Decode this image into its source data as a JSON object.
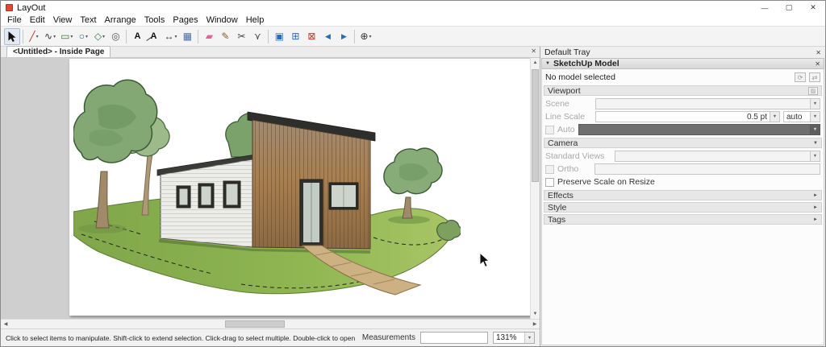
{
  "window": {
    "title": "LayOut"
  },
  "ui": {
    "minimize": "—",
    "maximize": "▢",
    "close": "✕",
    "dropdown_arrow": "▾",
    "combo_arrow": "▼",
    "panel_collapse": "▼",
    "section_expand": "►",
    "section_collapse": "▼",
    "scroll_up": "▲",
    "scroll_down": "▼",
    "scroll_left": "◀",
    "scroll_right": "▶",
    "refresh": "⟳",
    "swap": "⇄",
    "edit_view": "▨"
  },
  "menu": {
    "items": [
      "File",
      "Edit",
      "View",
      "Text",
      "Arrange",
      "Tools",
      "Pages",
      "Window",
      "Help"
    ]
  },
  "toolbar": {
    "tools": [
      {
        "id": "select",
        "glyph": ""
      },
      {
        "id": "line",
        "glyph": "╱"
      },
      {
        "id": "freehand",
        "glyph": "∿"
      },
      {
        "id": "rectangle",
        "glyph": "▭"
      },
      {
        "id": "circle",
        "glyph": "○"
      },
      {
        "id": "polygon",
        "glyph": "◇"
      },
      {
        "id": "offset",
        "glyph": "◎"
      },
      {
        "id": "text",
        "glyph": "A"
      },
      {
        "id": "label",
        "glyph": "A"
      },
      {
        "id": "dimension",
        "glyph": "↔"
      },
      {
        "id": "table",
        "glyph": "▦"
      },
      {
        "id": "eraser",
        "glyph": "▰"
      },
      {
        "id": "style",
        "glyph": "✎"
      },
      {
        "id": "split",
        "glyph": "✂"
      },
      {
        "id": "join",
        "glyph": "⋎"
      },
      {
        "id": "presentation",
        "glyph": "▣"
      },
      {
        "id": "add-page",
        "glyph": "⊞"
      },
      {
        "id": "delete-page",
        "glyph": "⊠"
      },
      {
        "id": "previous-page",
        "glyph": "◀"
      },
      {
        "id": "next-page",
        "glyph": "▶"
      },
      {
        "id": "zoom",
        "glyph": "⊕"
      }
    ]
  },
  "tab": {
    "label": "<Untitled> - Inside Page"
  },
  "tray": {
    "title": "Default Tray",
    "model_panel": {
      "title": "SketchUp Model",
      "status": "No model selected",
      "viewport_section": "Viewport",
      "scene_label": "Scene",
      "line_scale_label": "Line Scale",
      "line_scale_value": "0.5 pt",
      "line_scale_unit": "auto",
      "auto_label": "Auto",
      "camera_section": "Camera",
      "standard_views_label": "Standard Views",
      "ortho_label": "Ortho",
      "preserve_label": "Preserve Scale on Resize",
      "effects_section": "Effects",
      "style_section": "Style",
      "tags_section": "Tags"
    }
  },
  "statusbar": {
    "hint": "Click to select items to manipulate. Shift-click to extend selection. Click-drag to select multiple. Double-click to open editor.",
    "measurements_label": "Measurements",
    "measurements_value": "",
    "zoom_value": "131%"
  }
}
